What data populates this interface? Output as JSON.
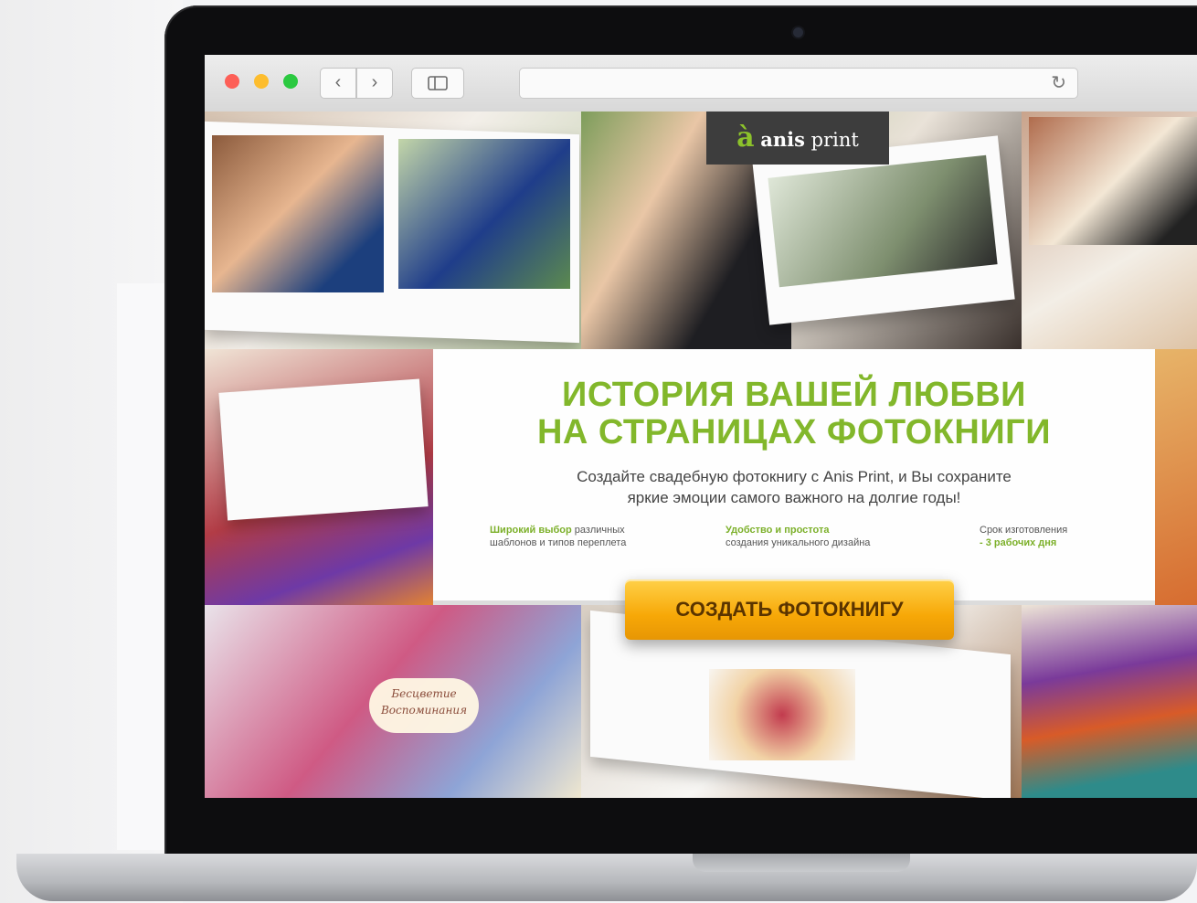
{
  "browser": {
    "back_icon": "‹",
    "forward_icon": "›",
    "sidebar_icon": "sidebar-icon",
    "reload_icon": "↻",
    "address_value": ""
  },
  "site": {
    "logo": {
      "mark": "à",
      "name_bold": "anis",
      "name_regular": " print"
    },
    "hero": {
      "title_line1": "ИСТОРИЯ ВАШЕЙ ЛЮБВИ",
      "title_line2": "НА СТРАНИЦАХ ФОТОКНИГИ",
      "subtitle_line1": "Создайте свадебную фотокнигу с Anis Print, и Вы сохраните",
      "subtitle_line2": "яркие эмоции самого важного на долгие годы!",
      "features": [
        {
          "highlight": "Широкий выбор",
          "rest_line1": " различных",
          "line2": "шаблонов и типов переплета"
        },
        {
          "highlight": "Удобство и простота",
          "rest_line1": "",
          "line2": "создания уникального дизайна"
        },
        {
          "line1": "Срок изготовления",
          "highlight": "- 3 рабочих дня"
        }
      ],
      "cta_label": "СОЗДАТЬ ФОТОКНИГУ"
    },
    "album_text": {
      "line1": "Бесцветие",
      "line2": "Воспоминания"
    }
  },
  "colors": {
    "accent_green": "#82b72b",
    "cta_orange": "#f7a807",
    "logo_bg": "#3d3d3d"
  }
}
